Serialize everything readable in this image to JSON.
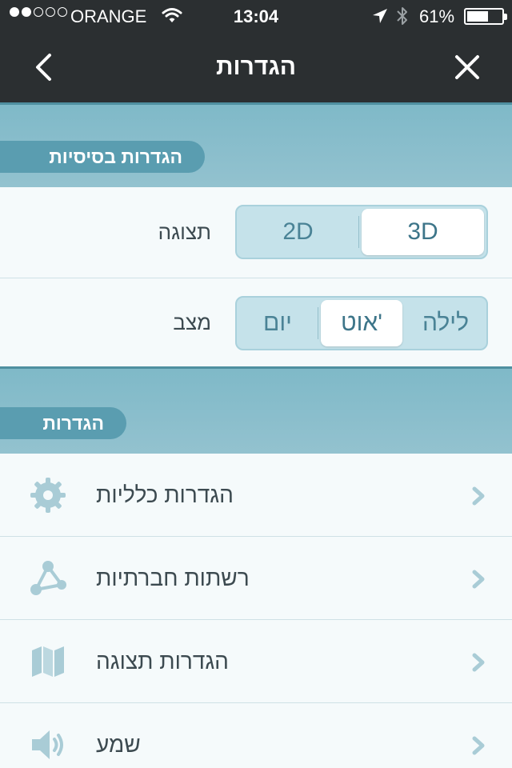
{
  "status_bar": {
    "carrier": "ORANGE",
    "time": "13:04",
    "battery_percent": "61%",
    "battery_level": 0.61,
    "signal_strength": 2
  },
  "nav": {
    "title": "הגדרות",
    "back_icon": "chevron-left-icon",
    "close_icon": "close-icon"
  },
  "basic_section": {
    "header": "הגדרות בסיסיות",
    "display_row": {
      "label": "תצוגה",
      "options": [
        "2D",
        "3D"
      ],
      "selected": "3D"
    },
    "mode_row": {
      "label": "מצב",
      "options": [
        "יום",
        "אוט'",
        "לילה"
      ],
      "selected": "אוט'"
    }
  },
  "settings_section": {
    "header": "הגדרות",
    "items": [
      {
        "label": "הגדרות כלליות",
        "icon": "gear-icon"
      },
      {
        "label": "רשתות חברתיות",
        "icon": "share-network-icon"
      },
      {
        "label": "הגדרות תצוגה",
        "icon": "map-icon"
      },
      {
        "label": "שמע",
        "icon": "speaker-icon"
      }
    ]
  },
  "colors": {
    "bar_background": "#2b2f31",
    "section_header": "#8ebfcc",
    "pill": "#5a9db0",
    "segment_text": "#4a8396",
    "icon": "#a9ccd6"
  }
}
